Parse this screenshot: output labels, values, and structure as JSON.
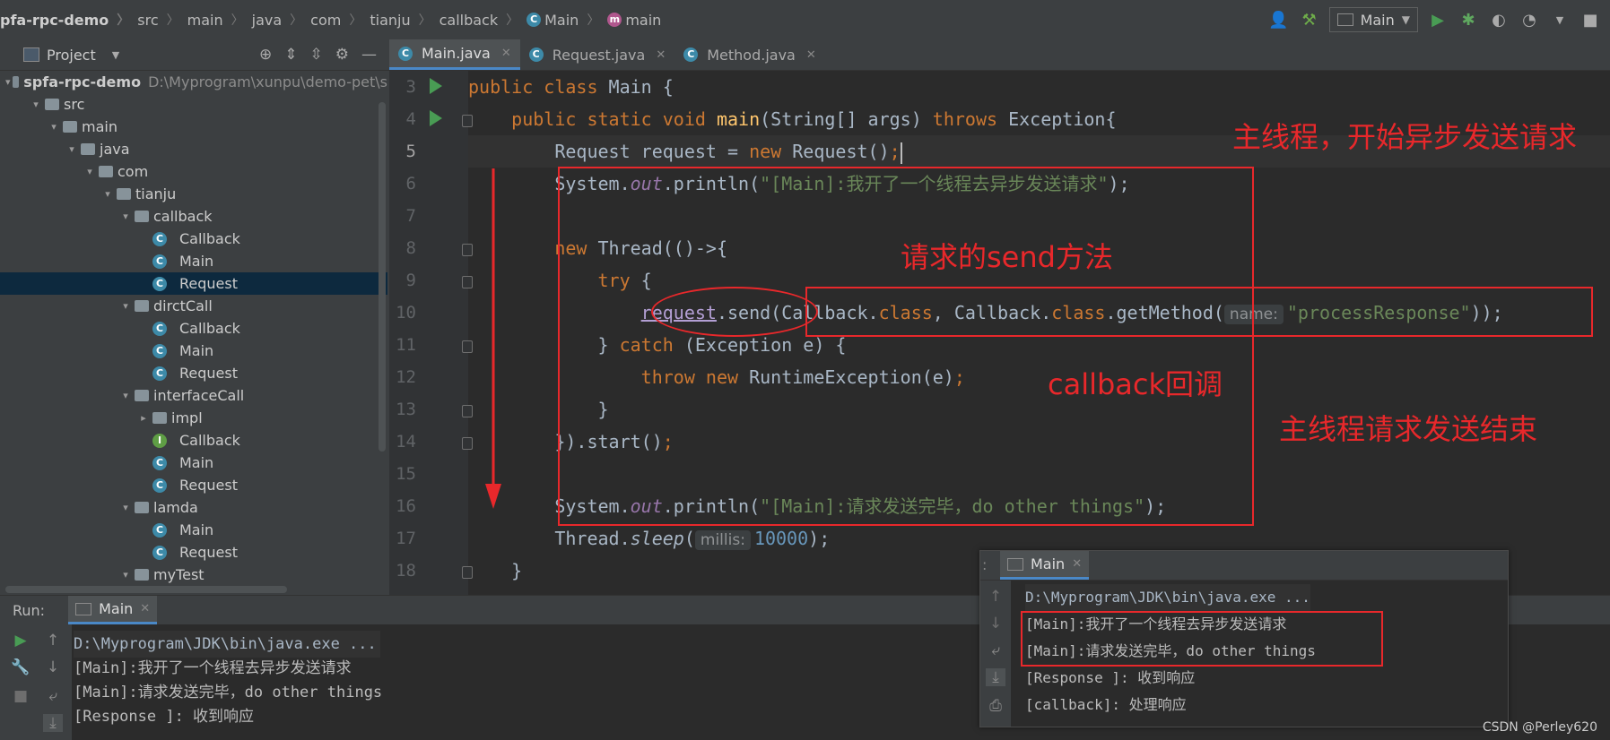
{
  "breadcrumbs": [
    "pfa-rpc-demo",
    "src",
    "main",
    "java",
    "com",
    "tianju",
    "callback",
    "Main",
    "main"
  ],
  "toolbar": {
    "run_config": "Main"
  },
  "project": {
    "header": "Project",
    "root_name": "spfa-rpc-demo",
    "root_path": "D:\\Myprogram\\xunpu\\demo-pet\\s",
    "tree": [
      {
        "label": "src",
        "kind": "folder",
        "depth": 1,
        "arrow": "▾"
      },
      {
        "label": "main",
        "kind": "folder",
        "depth": 2,
        "arrow": "▾"
      },
      {
        "label": "java",
        "kind": "folder",
        "depth": 3,
        "arrow": "▾"
      },
      {
        "label": "com",
        "kind": "package",
        "depth": 4,
        "arrow": "▾"
      },
      {
        "label": "tianju",
        "kind": "package",
        "depth": 5,
        "arrow": "▾"
      },
      {
        "label": "callback",
        "kind": "package",
        "depth": 6,
        "arrow": "▾"
      },
      {
        "label": "Callback",
        "kind": "class",
        "depth": 7,
        "arrow": ""
      },
      {
        "label": "Main",
        "kind": "class",
        "depth": 7,
        "arrow": ""
      },
      {
        "label": "Request",
        "kind": "class",
        "depth": 7,
        "arrow": "",
        "selected": true
      },
      {
        "label": "dirctCall",
        "kind": "package",
        "depth": 6,
        "arrow": "▾"
      },
      {
        "label": "Callback",
        "kind": "class",
        "depth": 7,
        "arrow": ""
      },
      {
        "label": "Main",
        "kind": "class",
        "depth": 7,
        "arrow": ""
      },
      {
        "label": "Request",
        "kind": "class",
        "depth": 7,
        "arrow": ""
      },
      {
        "label": "interfaceCall",
        "kind": "package",
        "depth": 6,
        "arrow": "▾"
      },
      {
        "label": "impl",
        "kind": "package",
        "depth": 7,
        "arrow": "▸"
      },
      {
        "label": "Callback",
        "kind": "interface",
        "depth": 7,
        "arrow": ""
      },
      {
        "label": "Main",
        "kind": "class",
        "depth": 7,
        "arrow": ""
      },
      {
        "label": "Request",
        "kind": "class",
        "depth": 7,
        "arrow": ""
      },
      {
        "label": "lamda",
        "kind": "package",
        "depth": 6,
        "arrow": "▾"
      },
      {
        "label": "Main",
        "kind": "class",
        "depth": 7,
        "arrow": ""
      },
      {
        "label": "Request",
        "kind": "class",
        "depth": 7,
        "arrow": ""
      },
      {
        "label": "myTest",
        "kind": "package",
        "depth": 6,
        "arrow": "▾"
      }
    ]
  },
  "editor_tabs": [
    {
      "label": "Main.java",
      "active": true
    },
    {
      "label": "Request.java",
      "active": false
    },
    {
      "label": "Method.java",
      "active": false
    }
  ],
  "code": {
    "line_numbers": [
      "3",
      "4",
      "5",
      "6",
      "7",
      "8",
      "9",
      "10",
      "11",
      "12",
      "13",
      "14",
      "15",
      "16",
      "17",
      "18"
    ],
    "l3a": "public class",
    "l3b": " Main {",
    "l4a": "    public static void ",
    "l4b": "main",
    "l4c": "(String[] args) ",
    "l4d": "throws",
    "l4e": " Exception{",
    "l5a": "        Request request = ",
    "l5b": "new",
    "l5c": " Request()",
    "l5d": ";",
    "l6a": "        System.",
    "l6b": "out",
    "l6c": ".println(",
    "l6d": "\"[Main]:我开了一个线程去异步发送请求\"",
    "l6e": ");",
    "l8a": "        ",
    "l8b": "new",
    "l8c": " Thread(()->{",
    "l9a": "            ",
    "l9b": "try",
    "l9c": " {",
    "l10a": "                ",
    "l10b": "request",
    "l10c": ".send(Callback.",
    "l10d": "class",
    "l10e": ", Callback.",
    "l10f": "class",
    "l10g": ".getMethod(",
    "l10h": "name:",
    "l10i": "\"processResponse\"",
    "l10j": "));",
    "l11a": "            } ",
    "l11b": "catch",
    "l11c": " (Exception e) {",
    "l12a": "                ",
    "l12b": "throw new",
    "l12c": " RuntimeException(e)",
    "l12d": ";",
    "l13a": "            }",
    "l14a": "        }).start()",
    "l14b": ";",
    "l16a": "        System.",
    "l16b": "out",
    "l16c": ".println(",
    "l16d": "\"[Main]:请求发送完毕，do other things\"",
    "l16e": ");",
    "l17a": "        Thread.",
    "l17b": "sleep",
    "l17c": "(",
    "l17d": "millis:",
    "l17e": "10000",
    "l17f": ");",
    "l18a": "    }"
  },
  "run": {
    "label": "Run:",
    "tab": "Main",
    "lines": [
      "D:\\Myprogram\\JDK\\bin\\java.exe ...",
      "[Main]:我开了一个线程去异步发送请求",
      "[Main]:请求发送完毕，do other things",
      "[Response ]: 收到响应"
    ]
  },
  "popup": {
    "tab": "Main",
    "lines": [
      "D:\\Myprogram\\JDK\\bin\\java.exe ...",
      "[Main]:我开了一个线程去异步发送请求",
      "[Main]:请求发送完毕，do other things",
      "[Response ]: 收到响应",
      "[callback]: 处理响应"
    ]
  },
  "annotations": {
    "main_start": "主线程，开始异步发送请求",
    "send_method": "请求的send方法",
    "callback": "callback回调",
    "main_end": "主线程请求发送结束"
  },
  "watermark": "CSDN @Perley620",
  "colors": {
    "annotation_red": "#e8282b",
    "keyword": "#cc7832",
    "string": "#6a8759",
    "selection": "#0d293e"
  }
}
